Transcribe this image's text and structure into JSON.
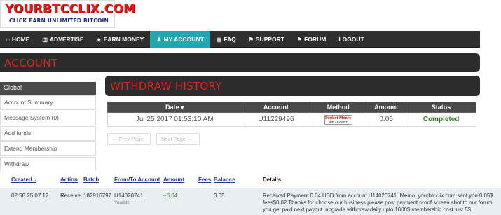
{
  "brand": {
    "logo_text": "YOURBTCCLIX.COM",
    "tagline": "CLICK EARN UNLIMITED BITCOIN",
    "colors": {
      "logo_red": "#e51a1a",
      "tagline_blue": "#1a2a8a",
      "nav_active": "#1fa7b3",
      "title_red": "#e02222",
      "status_green": "#2e7d1d"
    }
  },
  "nav": {
    "items": [
      {
        "label": "HOME",
        "icon": "home-icon"
      },
      {
        "label": "ADVERTISE",
        "icon": "cart-icon"
      },
      {
        "label": "EARN MONEY",
        "icon": "star-icon"
      },
      {
        "label": "MY ACCOUNT",
        "icon": "user-icon",
        "active": true
      },
      {
        "label": "FAQ",
        "icon": "book-icon"
      },
      {
        "label": "SUPPORT",
        "icon": "flag-icon"
      },
      {
        "label": "FORUM",
        "icon": "flag-icon"
      },
      {
        "label": "LOGOUT",
        "icon": ""
      }
    ]
  },
  "account": {
    "title": "ACCOUNT"
  },
  "sidebar": {
    "header": "Global",
    "items": [
      {
        "label": "Account Summary"
      },
      {
        "label": "Message System (0)"
      },
      {
        "label": "Add funds"
      },
      {
        "label": "Extend Membership"
      },
      {
        "label": "Withdraw"
      }
    ]
  },
  "withdraw": {
    "title": "WITHDRAW HISTORY",
    "columns": [
      "Date ▾",
      "Account",
      "Method",
      "Amount",
      "Status"
    ],
    "rows": [
      {
        "date": "Jul 25 2017 01:53:10 AM",
        "account": "U11229496",
        "method_name": "Perfect Money",
        "method_sub": "WE ACCEPT",
        "amount": "0.05",
        "status": "Completed"
      }
    ],
    "pager": {
      "prev": "← Prev Page",
      "next": "Next Page →"
    }
  },
  "transactions": {
    "headers": [
      "Created ↓",
      "Action",
      "Batch",
      "From/To Account",
      "Amount",
      "Fees",
      "Balance",
      "Details"
    ],
    "row": {
      "created": "02:58 25.07.17",
      "action": "Receive",
      "batch": "182916797",
      "account": "U14020741",
      "account_sub": "Yourbtc",
      "amount": "+0.04",
      "fees": "",
      "balance": "0.05",
      "details": "Received Payment 0.04 USD from account U14020741. Memo: yourbtcclix.com sent you 0.05$ fees$0.02.Thanks for choose our business please post payment proof screen shot to our forum you get paid next payout. upgrade withdraw daily upto 1000$ membership cost just 5$."
    }
  }
}
